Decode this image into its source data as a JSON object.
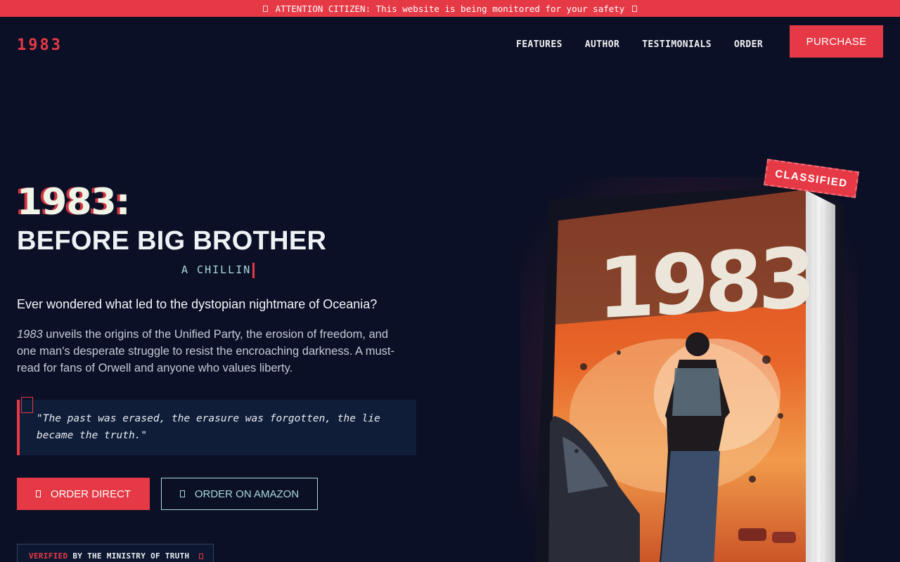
{
  "banner": {
    "text": "ATTENTION CITIZEN: This website is being monitored for your safety"
  },
  "nav": {
    "logo": "1983",
    "links": [
      "FEATURES",
      "AUTHOR",
      "TESTIMONIALS",
      "ORDER"
    ],
    "purchase_label": "PURCHASE"
  },
  "hero": {
    "title": "1983:",
    "subtitle": "BEFORE BIG BROTHER",
    "typing_text": "A CHILLIN",
    "lead": "Ever wondered what led to the dystopian nightmare of Oceania?",
    "desc_em": "1983",
    "desc_rest": " unveils the origins of the Unified Party, the erosion of freedom, and one man's desperate struggle to resist the encroaching darkness. A must-read for fans of Orwell and anyone who values liberty.",
    "quote": "\"The past was erased, the erasure was forgotten, the lie became the truth.\"",
    "order_direct_label": "ORDER DIRECT",
    "order_amazon_label": "ORDER ON AMAZON",
    "verified_red": "VERIFIED",
    "verified_rest": " BY THE MINISTRY OF TRUTH"
  },
  "book": {
    "cover_title": "1983",
    "stamp": "CLASSIFIED"
  },
  "colors": {
    "accent": "#e63946",
    "background": "#0b1026",
    "secondary": "#a8dadc"
  },
  "icons": {
    "banner": "eye-icon",
    "order_direct": "cart-icon",
    "order_amazon": "amazon-icon",
    "verified": "check-icon",
    "quote": "quote-icon"
  }
}
